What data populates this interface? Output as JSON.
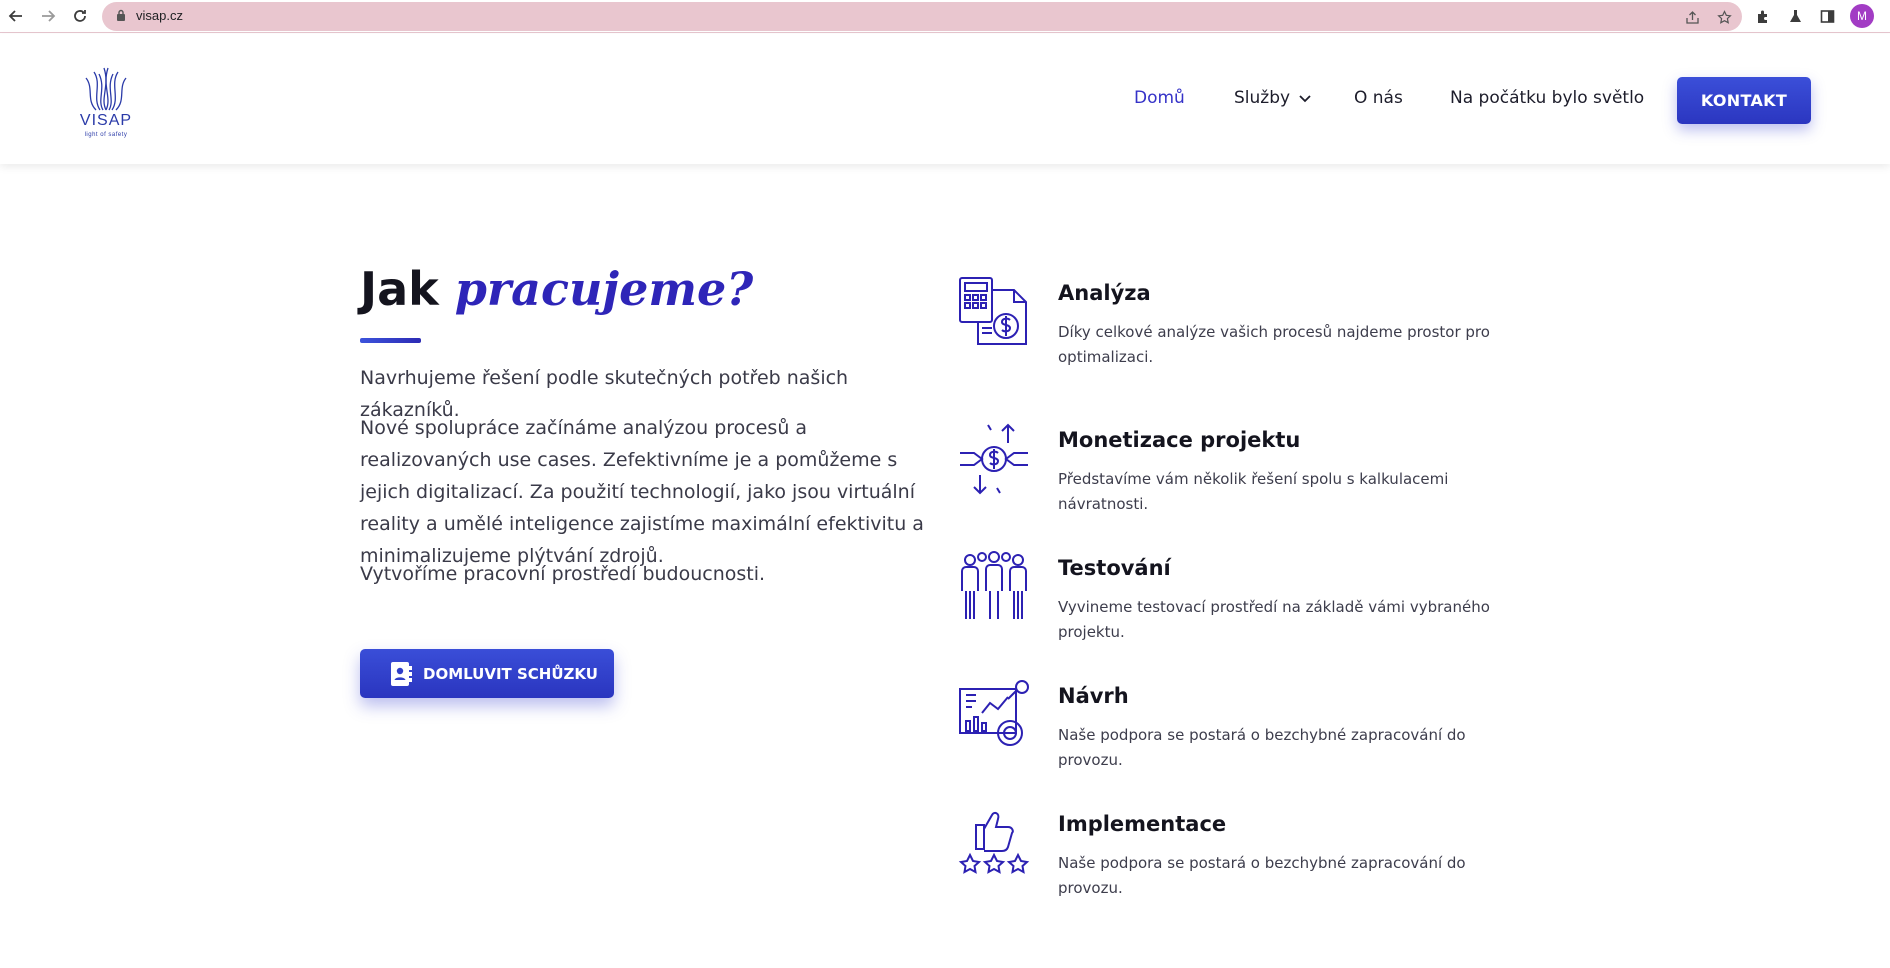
{
  "browser": {
    "url": "visap.cz",
    "profile_initial": "M"
  },
  "site": {
    "logo_text": "VISAP",
    "logo_tagline": "light of safety",
    "nav": [
      {
        "label": "Domů",
        "active": true
      },
      {
        "label": "Služby",
        "active": false
      },
      {
        "label": "O nás",
        "active": false
      },
      {
        "label": "Na počátku bylo světlo",
        "active": false
      }
    ],
    "cta_label": "KONTAKT"
  },
  "section": {
    "heading_plain": "Jak",
    "heading_accent": "pracujeme?",
    "paragraphs": [
      "Navrhujeme řešení podle skutečných potřeb našich zákazníků.",
      "Nové spolupráce začínáme analýzou procesů a realizovaných use cases. Zefektivníme je a pomůžeme s jejich digitalizací. Za použití technologií, jako jsou virtuální reality a umělé inteligence zajistíme maximální efektivitu a minimalizujeme plýtvání zdrojů.",
      "Vytvoříme pracovní prostředí budoucnosti."
    ],
    "button_label": "DOMLUVIT SCHŮZKU"
  },
  "steps": [
    {
      "title": "Analýza",
      "desc": "Díky celkové analýze vašich procesů najdeme prostor pro optimalizaci.",
      "icon": "calculator-money-icon"
    },
    {
      "title": "Monetizace projektu",
      "desc": "Představíme vám několik řešení spolu s kalkulacemi návratnosti.",
      "icon": "money-exchange-icon"
    },
    {
      "title": "Testování",
      "desc": "Vyvineme testovací prostředí na základě vámi vybraného projektu.",
      "icon": "team-icon"
    },
    {
      "title": "Návrh",
      "desc": "Naše podpora se postará o bezchybné zapracování do provozu.",
      "icon": "analytics-icon"
    },
    {
      "title": "Implementace",
      "desc": "Naše podpora se postará o bezchybné zapracování do provozu.",
      "icon": "thumbs-up-rating-icon"
    }
  ],
  "colors": {
    "accent": "#2e25b8",
    "button": "#3b4fd9",
    "icon": "#2c21b3"
  }
}
